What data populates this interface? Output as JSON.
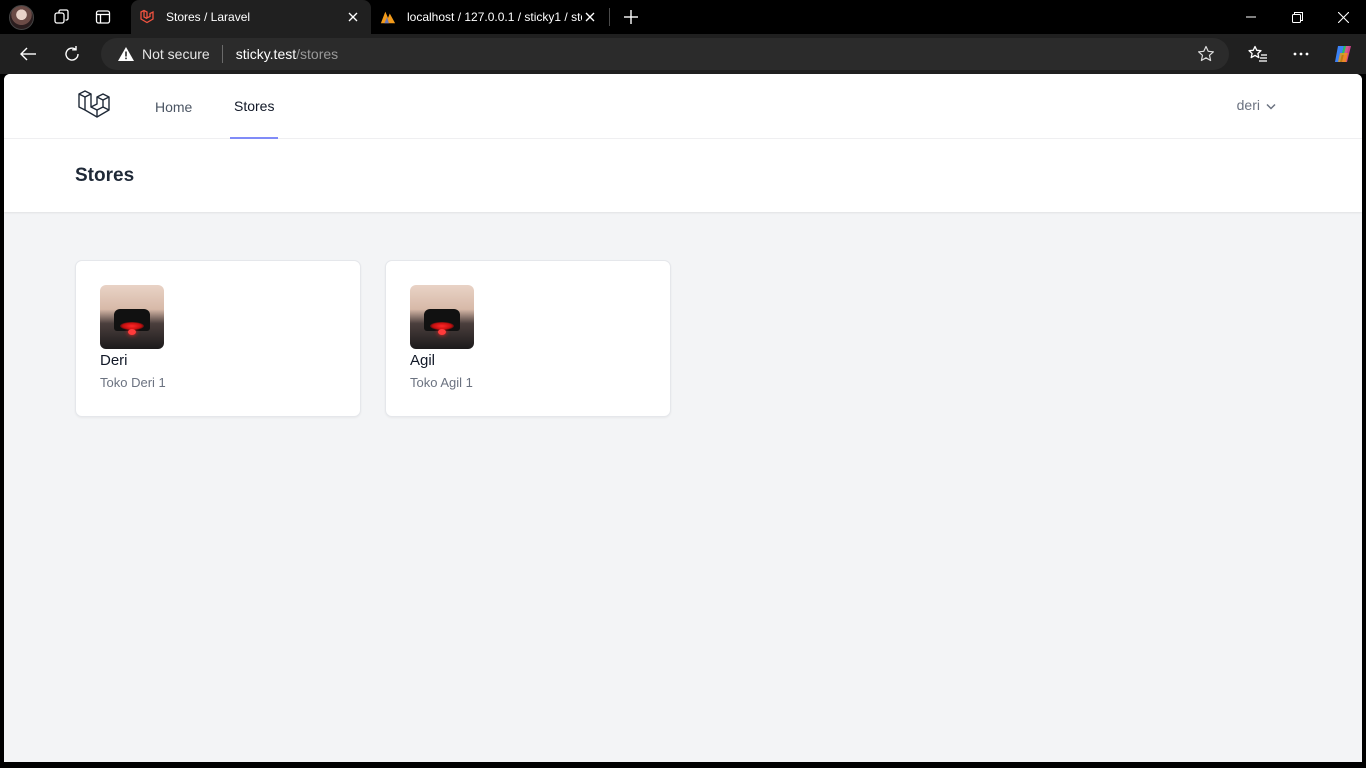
{
  "browser": {
    "tabs": [
      {
        "title": "Stores / Laravel",
        "active": true
      },
      {
        "title": "localhost / 127.0.0.1 / sticky1 / sto",
        "active": false
      }
    ],
    "address": {
      "security_label": "Not secure",
      "host": "sticky.test",
      "path": "/stores"
    }
  },
  "nav": {
    "links": [
      {
        "label": "Home"
      },
      {
        "label": "Stores"
      }
    ],
    "user": "deri"
  },
  "page": {
    "title": "Stores"
  },
  "stores": [
    {
      "name": "Deri",
      "description": "Toko Deri 1"
    },
    {
      "name": "Agil",
      "description": "Toko Agil 1"
    }
  ],
  "colors": {
    "accent": "#818cf8",
    "page_bg": "#f3f4f6",
    "chrome_bg": "#202020"
  }
}
